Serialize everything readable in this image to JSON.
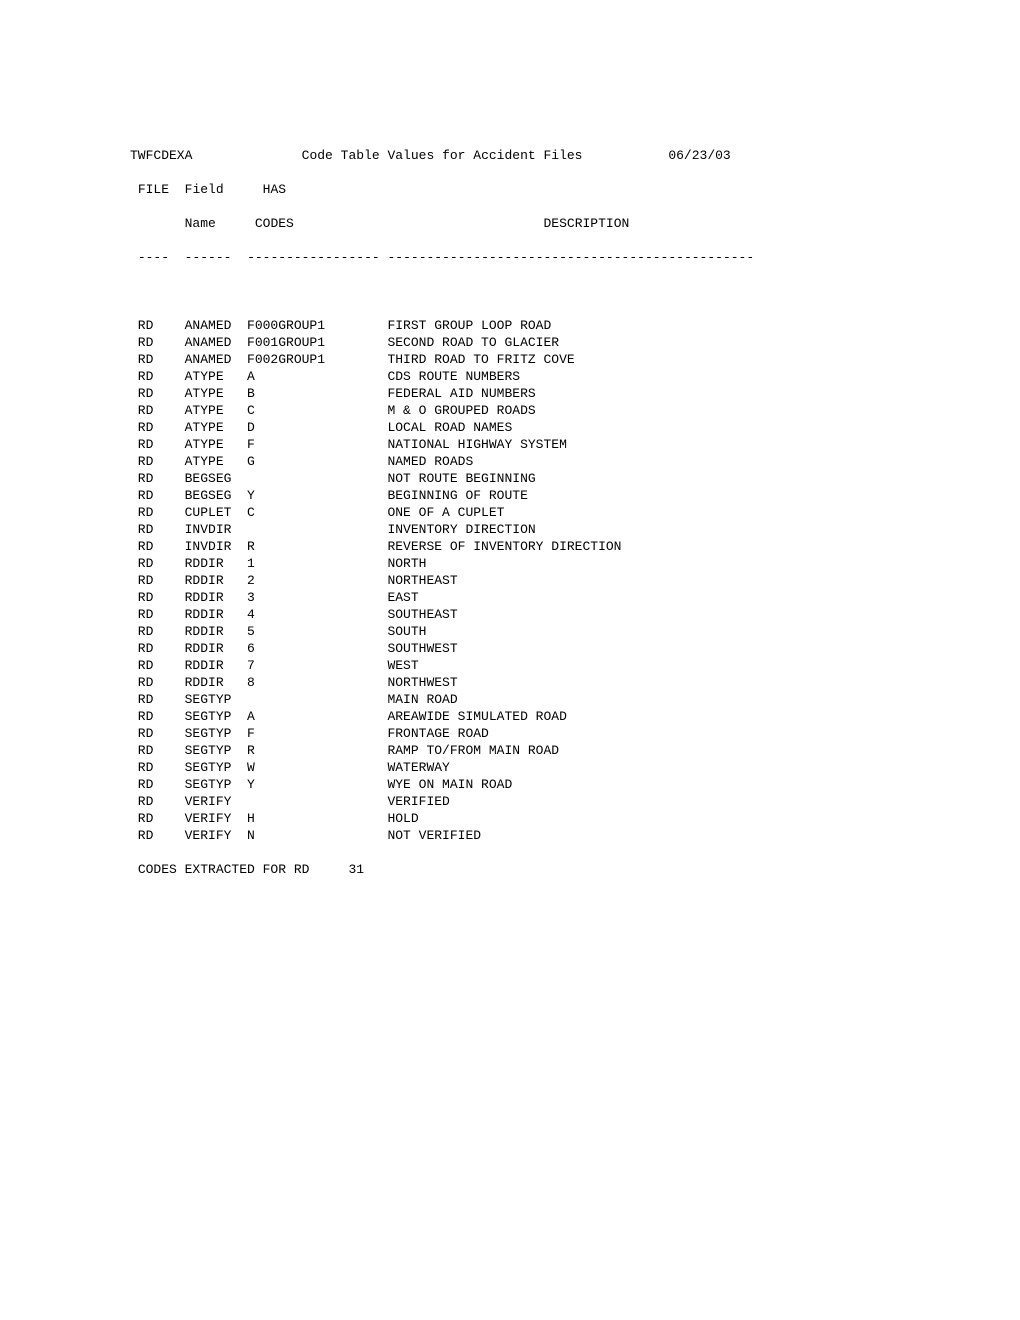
{
  "header": {
    "report_id": "TWFCDEXA",
    "title": "Code Table Values for Accident Files",
    "date": "06/23/03",
    "col_file_label": "FILE",
    "col_field_label": "Field",
    "col_has_label": "HAS",
    "col_name_label": "Name",
    "col_codes_label": "CODES",
    "col_description_label": "DESCRIPTION",
    "divider_file": "----",
    "divider_field": "------",
    "divider_codes": "-----------------",
    "divider_description": "-----------------------------------------------"
  },
  "rows": [
    {
      "file": "RD",
      "field": "ANAMED",
      "code": "F000GROUP1",
      "desc": "FIRST GROUP LOOP ROAD"
    },
    {
      "file": "RD",
      "field": "ANAMED",
      "code": "F001GROUP1",
      "desc": "SECOND ROAD TO GLACIER"
    },
    {
      "file": "RD",
      "field": "ANAMED",
      "code": "F002GROUP1",
      "desc": "THIRD ROAD TO FRITZ COVE"
    },
    {
      "file": "RD",
      "field": "ATYPE",
      "code": "A",
      "desc": "CDS ROUTE NUMBERS"
    },
    {
      "file": "RD",
      "field": "ATYPE",
      "code": "B",
      "desc": "FEDERAL AID NUMBERS"
    },
    {
      "file": "RD",
      "field": "ATYPE",
      "code": "C",
      "desc": "M & O GROUPED ROADS"
    },
    {
      "file": "RD",
      "field": "ATYPE",
      "code": "D",
      "desc": "LOCAL ROAD NAMES"
    },
    {
      "file": "RD",
      "field": "ATYPE",
      "code": "F",
      "desc": "NATIONAL HIGHWAY SYSTEM"
    },
    {
      "file": "RD",
      "field": "ATYPE",
      "code": "G",
      "desc": "NAMED ROADS"
    },
    {
      "file": "RD",
      "field": "BEGSEG",
      "code": "",
      "desc": "NOT ROUTE BEGINNING"
    },
    {
      "file": "RD",
      "field": "BEGSEG",
      "code": "Y",
      "desc": "BEGINNING OF ROUTE"
    },
    {
      "file": "RD",
      "field": "CUPLET",
      "code": "C",
      "desc": "ONE OF A CUPLET"
    },
    {
      "file": "RD",
      "field": "INVDIR",
      "code": "",
      "desc": "INVENTORY DIRECTION"
    },
    {
      "file": "RD",
      "field": "INVDIR",
      "code": "R",
      "desc": "REVERSE OF INVENTORY DIRECTION"
    },
    {
      "file": "RD",
      "field": "RDDIR",
      "code": "1",
      "desc": "NORTH"
    },
    {
      "file": "RD",
      "field": "RDDIR",
      "code": "2",
      "desc": "NORTHEAST"
    },
    {
      "file": "RD",
      "field": "RDDIR",
      "code": "3",
      "desc": "EAST"
    },
    {
      "file": "RD",
      "field": "RDDIR",
      "code": "4",
      "desc": "SOUTHEAST"
    },
    {
      "file": "RD",
      "field": "RDDIR",
      "code": "5",
      "desc": "SOUTH"
    },
    {
      "file": "RD",
      "field": "RDDIR",
      "code": "6",
      "desc": "SOUTHWEST"
    },
    {
      "file": "RD",
      "field": "RDDIR",
      "code": "7",
      "desc": "WEST"
    },
    {
      "file": "RD",
      "field": "RDDIR",
      "code": "8",
      "desc": "NORTHWEST"
    },
    {
      "file": "RD",
      "field": "SEGTYP",
      "code": "",
      "desc": "MAIN ROAD"
    },
    {
      "file": "RD",
      "field": "SEGTYP",
      "code": "A",
      "desc": "AREAWIDE SIMULATED ROAD"
    },
    {
      "file": "RD",
      "field": "SEGTYP",
      "code": "F",
      "desc": "FRONTAGE ROAD"
    },
    {
      "file": "RD",
      "field": "SEGTYP",
      "code": "R",
      "desc": "RAMP TO/FROM MAIN ROAD"
    },
    {
      "file": "RD",
      "field": "SEGTYP",
      "code": "W",
      "desc": "WATERWAY"
    },
    {
      "file": "RD",
      "field": "SEGTYP",
      "code": "Y",
      "desc": "WYE ON MAIN ROAD"
    },
    {
      "file": "RD",
      "field": "VERIFY",
      "code": "",
      "desc": "VERIFIED"
    },
    {
      "file": "RD",
      "field": "VERIFY",
      "code": "H",
      "desc": "HOLD"
    },
    {
      "file": "RD",
      "field": "VERIFY",
      "code": "N",
      "desc": "NOT VERIFIED"
    }
  ],
  "footer": {
    "text": "CODES EXTRACTED FOR RD",
    "count": "31"
  }
}
